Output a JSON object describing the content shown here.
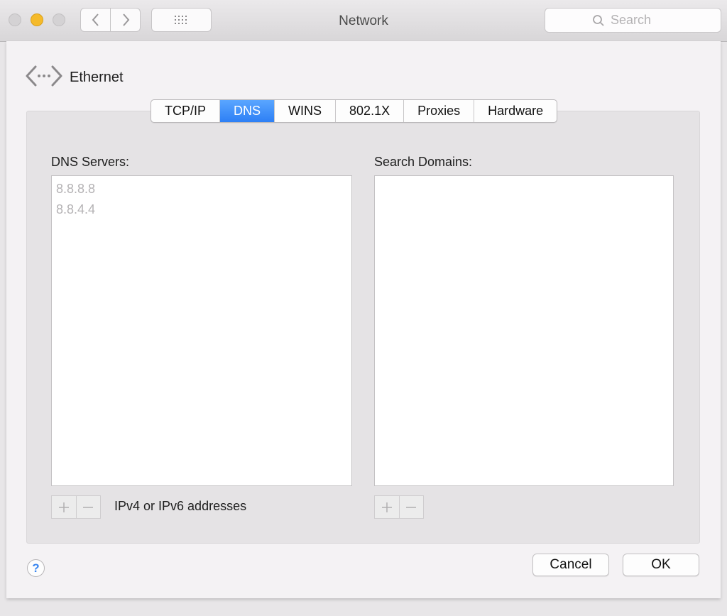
{
  "window": {
    "title": "Network",
    "search_placeholder": "Search",
    "back_icon": "chevron-left-icon",
    "forward_icon": "chevron-right-icon",
    "grid_icon": "show-all-grid-icon",
    "search_icon": "magnifier-icon"
  },
  "connection": {
    "name": "Ethernet",
    "icon": "ethernet-arrows-icon"
  },
  "tabs": [
    "TCP/IP",
    "DNS",
    "WINS",
    "802.1X",
    "Proxies",
    "Hardware"
  ],
  "active_tab": "DNS",
  "dns": {
    "servers_label": "DNS Servers:",
    "servers": [
      "8.8.8.8",
      "8.8.4.4"
    ],
    "servers_hint": "IPv4 or IPv6 addresses",
    "domains_label": "Search Domains:",
    "domains": []
  },
  "footer": {
    "help_label": "?",
    "cancel_label": "Cancel",
    "ok_label": "OK"
  },
  "colors": {
    "accent": "#2d7ff5",
    "minimize_light": "#f5ba2a",
    "help_glyph": "#3a86f0"
  }
}
